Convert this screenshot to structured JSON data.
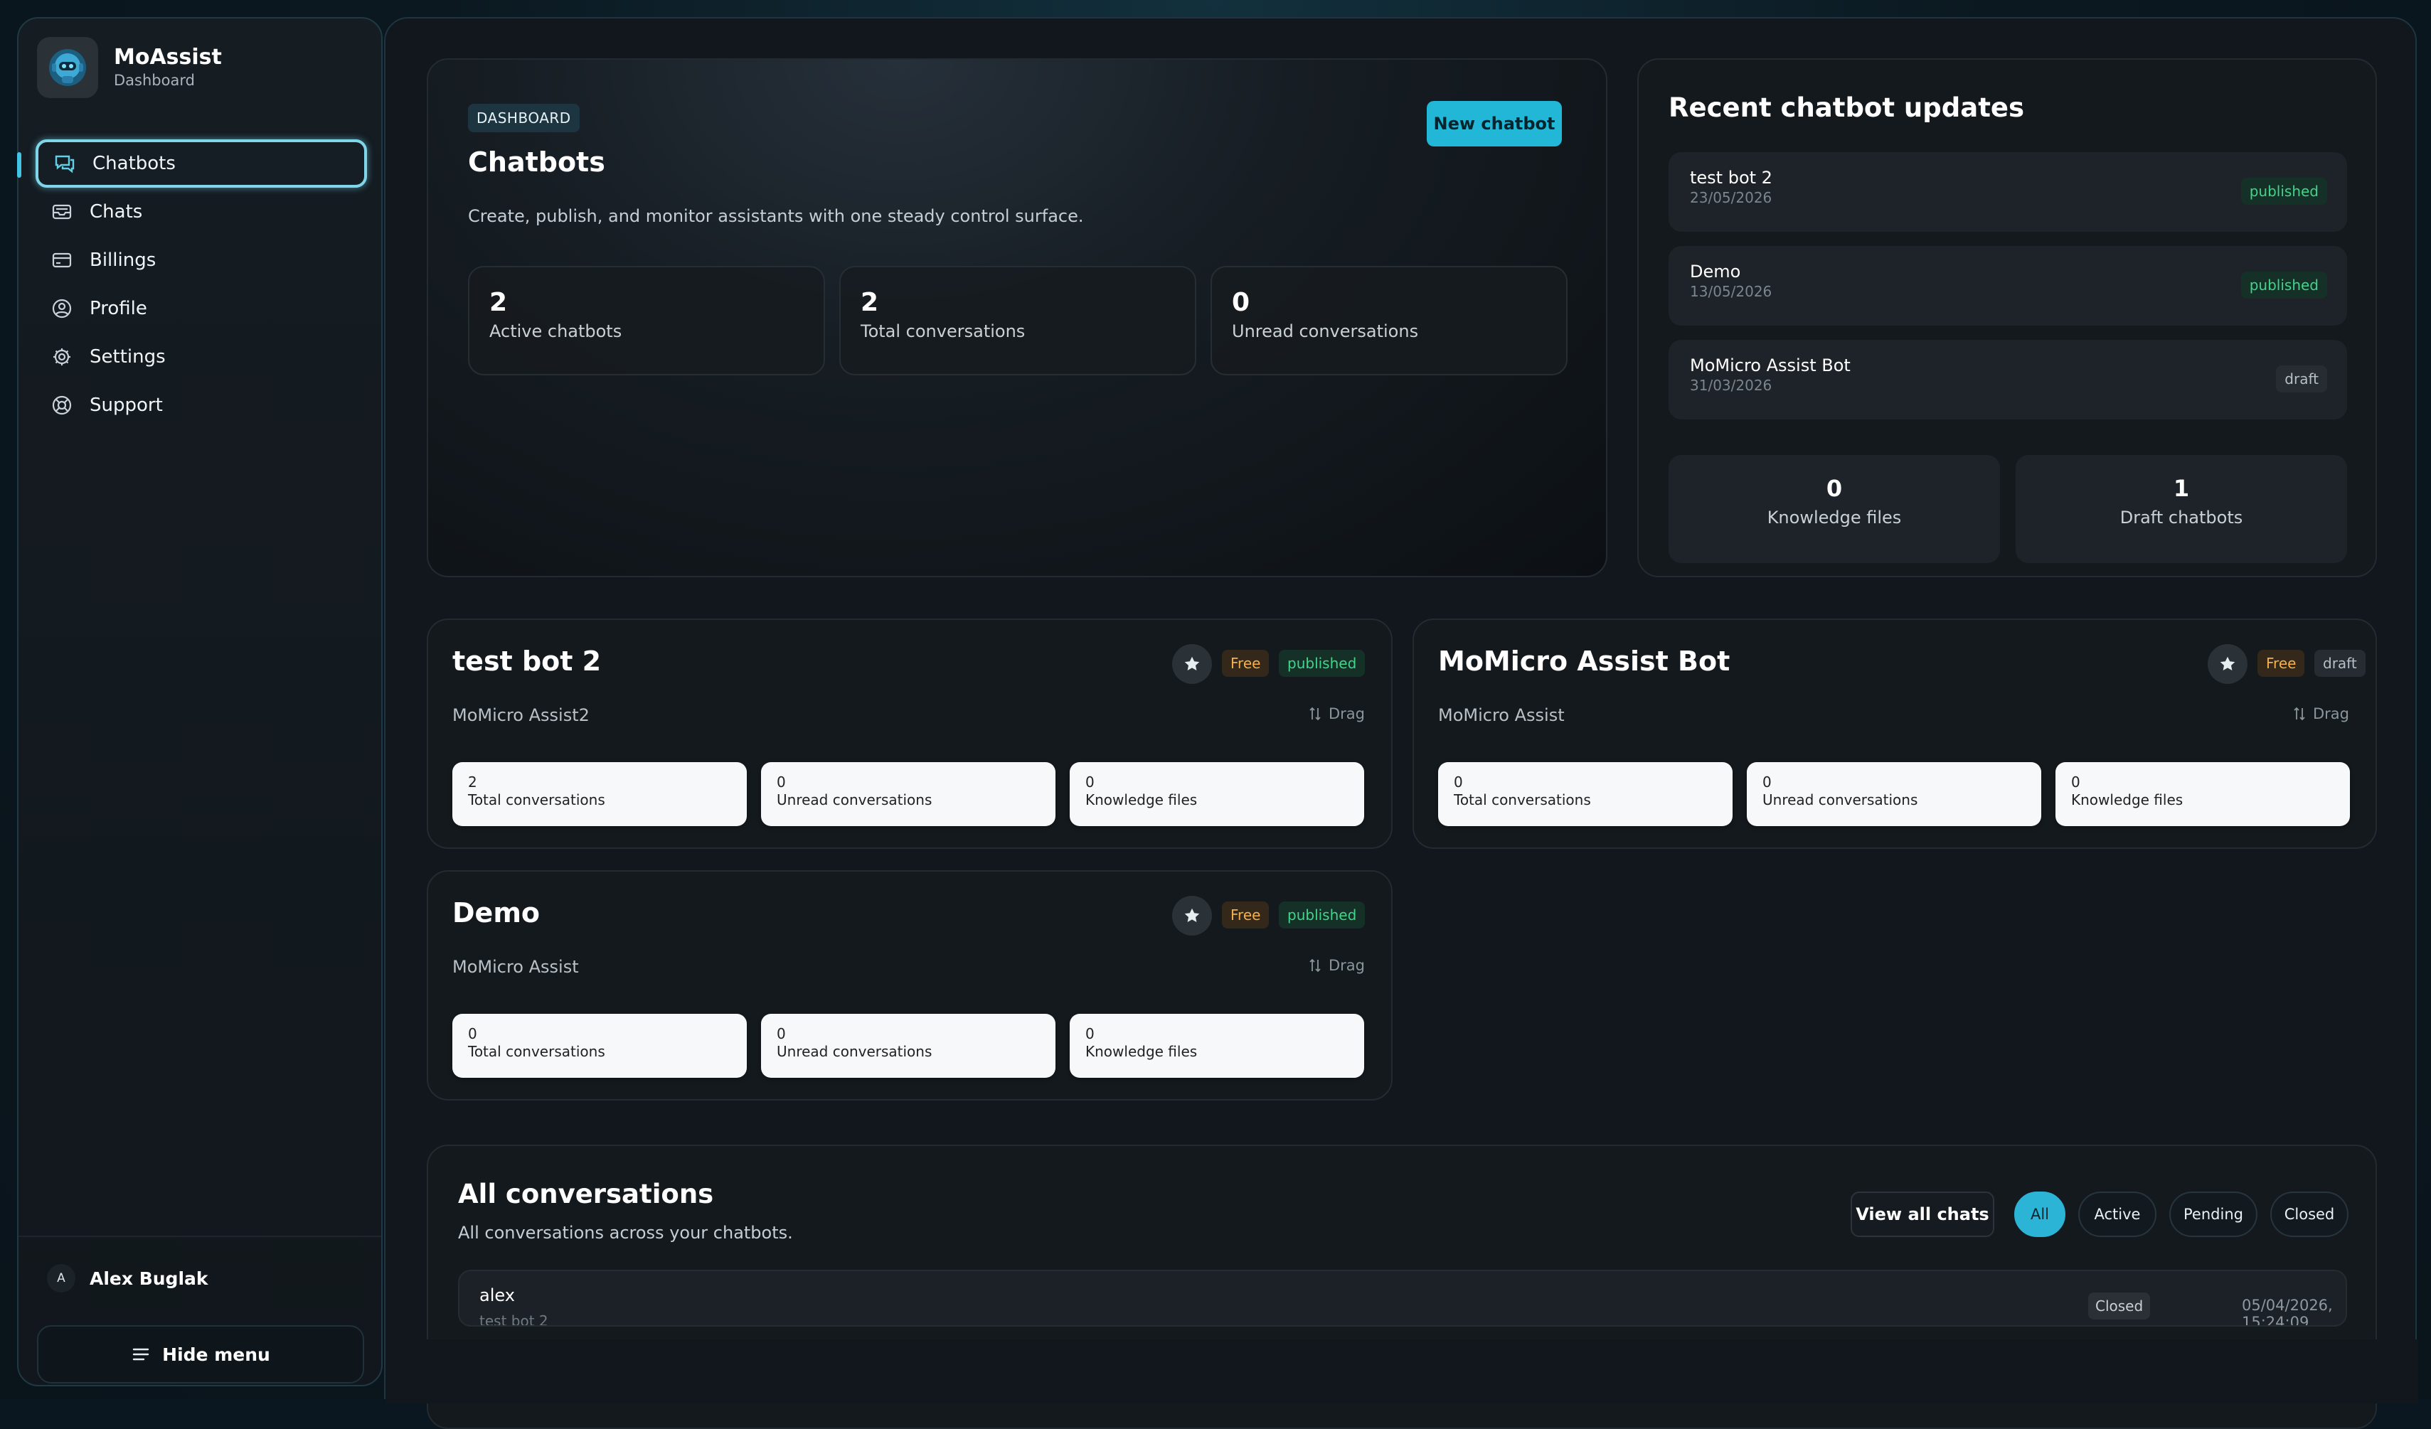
{
  "brand": {
    "name": "MoAssist",
    "subtitle": "Dashboard"
  },
  "sidebar": {
    "items": [
      {
        "label": "Chatbots",
        "icon": "chat-bubbles-icon",
        "active": true
      },
      {
        "label": "Chats",
        "icon": "inbox-icon"
      },
      {
        "label": "Billings",
        "icon": "credit-card-icon"
      },
      {
        "label": "Profile",
        "icon": "user-circle-icon"
      },
      {
        "label": "Settings",
        "icon": "gear-icon"
      },
      {
        "label": "Support",
        "icon": "lifebuoy-icon"
      }
    ],
    "user": {
      "initial": "A",
      "name": "Alex Buglak"
    },
    "hide_menu_label": "Hide menu"
  },
  "hero": {
    "badge": "DASHBOARD",
    "title": "Chatbots",
    "description": "Create, publish, and monitor assistants with one steady control surface.",
    "new_button": "New chatbot",
    "stats": [
      {
        "value": "2",
        "label": "Active chatbots"
      },
      {
        "value": "2",
        "label": "Total conversations"
      },
      {
        "value": "0",
        "label": "Unread conversations"
      }
    ]
  },
  "recent": {
    "title": "Recent chatbot updates",
    "items": [
      {
        "name": "test bot 2",
        "date": "23/05/2026",
        "status": "published"
      },
      {
        "name": "Demo",
        "date": "13/05/2026",
        "status": "published"
      },
      {
        "name": "MoMicro Assist Bot",
        "date": "31/03/2026",
        "status": "draft"
      }
    ],
    "stats": [
      {
        "value": "0",
        "label": "Knowledge files"
      },
      {
        "value": "1",
        "label": "Draft chatbots"
      }
    ]
  },
  "bots": [
    {
      "title": "test bot 2",
      "subtitle": "MoMicro Assist2",
      "plan": "Free",
      "status": "published",
      "drag": "Drag",
      "stats": [
        {
          "value": "2",
          "label": "Total conversations"
        },
        {
          "value": "0",
          "label": "Unread conversations"
        },
        {
          "value": "0",
          "label": "Knowledge files"
        }
      ]
    },
    {
      "title": "MoMicro Assist Bot",
      "subtitle": "MoMicro Assist",
      "plan": "Free",
      "status": "draft",
      "drag": "Drag",
      "stats": [
        {
          "value": "0",
          "label": "Total conversations"
        },
        {
          "value": "0",
          "label": "Unread conversations"
        },
        {
          "value": "0",
          "label": "Knowledge files"
        }
      ]
    },
    {
      "title": "Demo",
      "subtitle": "MoMicro Assist",
      "plan": "Free",
      "status": "published",
      "drag": "Drag",
      "stats": [
        {
          "value": "0",
          "label": "Total conversations"
        },
        {
          "value": "0",
          "label": "Unread conversations"
        },
        {
          "value": "0",
          "label": "Knowledge files"
        }
      ]
    }
  ],
  "conversations": {
    "title": "All conversations",
    "subtitle": "All conversations across your chatbots.",
    "view_all": "View all chats",
    "filters": [
      "All",
      "Active",
      "Pending",
      "Closed"
    ],
    "active_filter": "All",
    "rows": [
      {
        "name": "alex",
        "bot": "test bot 2",
        "status": "Closed",
        "time": "05/04/2026, 15:24:09"
      }
    ]
  },
  "colors": {
    "accent": "#22b6d7",
    "published": "#43d38a",
    "free": "#f2b14c"
  }
}
